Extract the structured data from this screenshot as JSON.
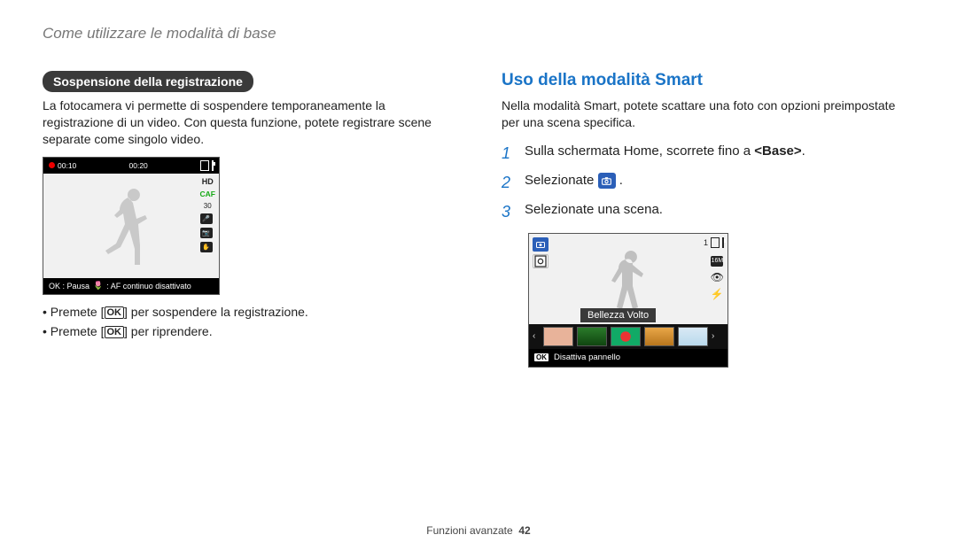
{
  "breadcrumb": "Come utilizzare le modalità di base",
  "left": {
    "pill": "Sospensione della registrazione",
    "intro": "La fotocamera vi permette di sospendere temporaneamente la registrazione di un video. Con questa funzione, potete registrare scene separate come singolo video.",
    "lcd": {
      "time1": "00:10",
      "time2": "00:20",
      "caf": "CAF",
      "hd": "HD",
      "fps": "30",
      "bottom_left": "OK : Pausa",
      "bottom_right": " : AF continuo disattivato"
    },
    "bullet1_pre": "Premete [",
    "bullet1_post": "] per sospendere la registrazione.",
    "bullet2_pre": "Premete [",
    "bullet2_post": "] per riprendere.",
    "ok_label": "OK"
  },
  "right": {
    "heading": "Uso della modalità Smart",
    "intro": "Nella modalità Smart, potete scattare una foto con opzioni preimpostate per una scena specifica.",
    "step1_num": "1",
    "step1_pre": "Sulla schermata Home, scorrete fino a ",
    "step1_bold": "<Base>",
    "step1_post": ".",
    "step2_num": "2",
    "step2_pre": "Selezionate ",
    "step2_post": " .",
    "step3_num": "3",
    "step3_txt": "Selezionate una scena.",
    "lcd": {
      "top_count": "1",
      "label": "Bellezza Volto",
      "bottom_ok": "OK",
      "bottom_txt": "Disattiva pannello"
    }
  },
  "footer": {
    "section": "Funzioni avanzate",
    "page": "42"
  }
}
